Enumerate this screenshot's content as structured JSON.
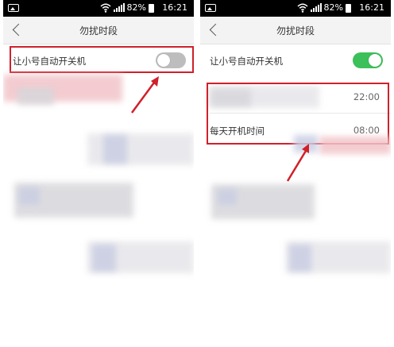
{
  "colors": {
    "accent_red": "#d0202a",
    "toggle_on": "#3cc05a",
    "toggle_off": "#bdbdbd",
    "nav_bg": "#f3f3f3",
    "status_bg": "#000000"
  },
  "status_bar": {
    "battery_percent": "82%",
    "time": "16:21",
    "icons": [
      "image-icon",
      "wifi-icon",
      "signal-icon",
      "battery-icon"
    ]
  },
  "left_screen": {
    "nav_title": "勿扰时段",
    "auto_power_toggle": {
      "label": "让小号自动开关机",
      "state": "off"
    }
  },
  "right_screen": {
    "nav_title": "勿扰时段",
    "auto_power_toggle": {
      "label": "让小号自动开关机",
      "state": "on"
    },
    "shutdown_row": {
      "value": "22:00"
    },
    "startup_row": {
      "label": "每天开机时间",
      "value": "08:00"
    }
  }
}
